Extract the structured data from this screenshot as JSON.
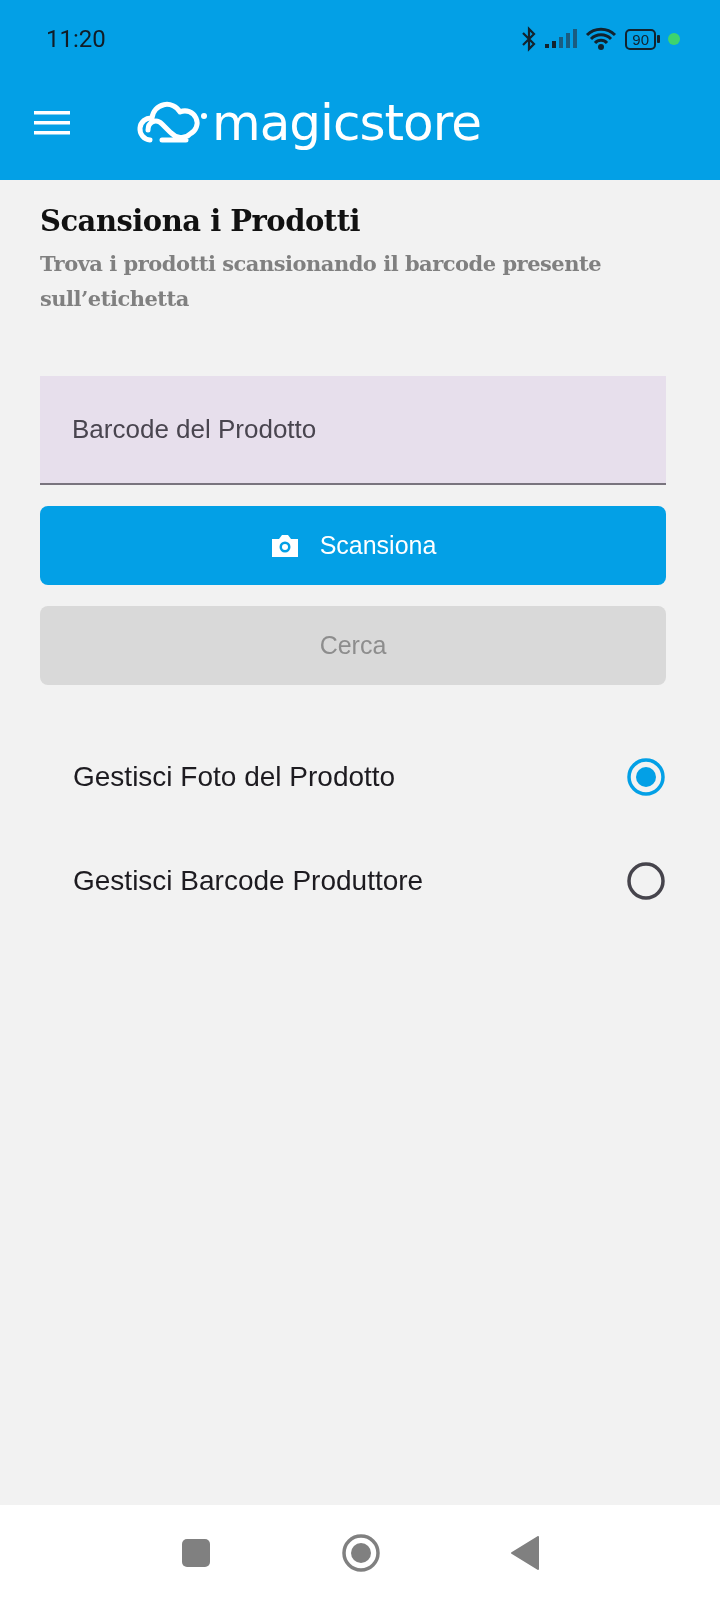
{
  "status_bar": {
    "time": "11:20",
    "battery": "90"
  },
  "app_bar": {
    "logo": "magicstore"
  },
  "header": {
    "title": "Scansiona i Prodotti",
    "subtitle": "Trova i prodotti scansionando il barcode presente sull’etichetta"
  },
  "barcode_field": {
    "placeholder": "Barcode del Prodotto"
  },
  "buttons": [
    {
      "label": "Scansiona",
      "kind": "scan",
      "disabled": false
    },
    {
      "label": "Cerca",
      "kind": "plain",
      "disabled": true
    }
  ],
  "options": [
    {
      "label": "Gestisci Foto del Prodotto",
      "selected": true
    },
    {
      "label": "Gestisci Barcode Produttore",
      "selected": false
    }
  ]
}
